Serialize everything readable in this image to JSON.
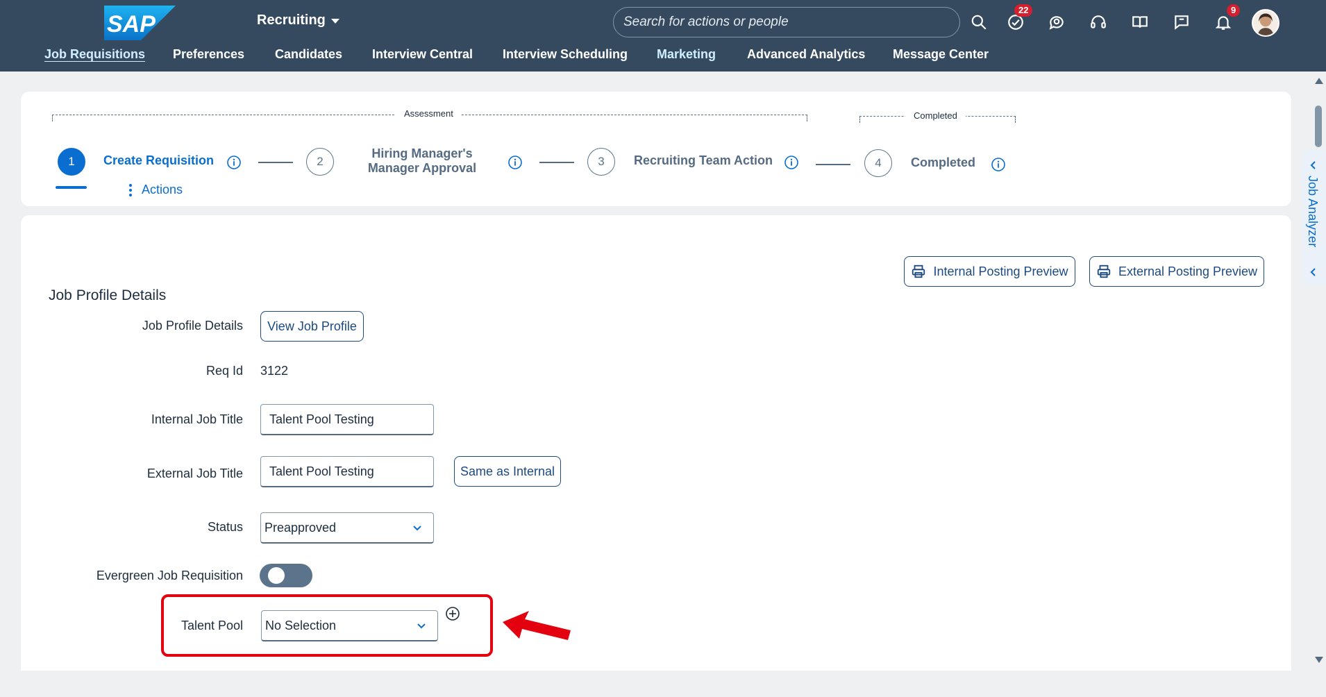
{
  "header": {
    "logo_text": "SAP",
    "app_switch_label": "Recruiting",
    "search_placeholder": "Search for actions or people",
    "todo_badge": "22",
    "notification_badge": "9"
  },
  "nav": {
    "items": [
      "Job Requisitions",
      "Preferences",
      "Candidates",
      "Interview Central",
      "Interview Scheduling",
      "Marketing",
      "Advanced Analytics",
      "Message Center"
    ]
  },
  "stepper": {
    "bracket_assessment": "Assessment",
    "bracket_completed": "Completed",
    "steps": [
      {
        "number": "1",
        "label": "Create Requisition"
      },
      {
        "number": "2",
        "label_line1": "Hiring Manager's",
        "label_line2": "Manager Approval"
      },
      {
        "number": "3",
        "label": "Recruiting Team Action"
      },
      {
        "number": "4",
        "label": "Completed"
      }
    ],
    "actions_label": "Actions"
  },
  "side_tab": {
    "label": "Job Analyzer"
  },
  "form": {
    "internal_preview_label": "Internal Posting Preview",
    "external_preview_label": "External Posting Preview",
    "section_title": "Job Profile Details",
    "job_profile_label": "Job Profile Details",
    "view_job_profile_label": "View Job Profile",
    "req_id_label": "Req Id",
    "req_id_value": "3122",
    "internal_title_label": "Internal Job Title",
    "internal_title_value": "Talent Pool Testing",
    "external_title_label": "External Job Title",
    "external_title_value": "Talent Pool Testing",
    "same_as_internal_label": "Same as Internal",
    "status_label": "Status",
    "status_value": "Preapproved",
    "evergreen_label": "Evergreen Job Requisition",
    "talent_pool_label": "Talent Pool",
    "talent_pool_value": "No Selection"
  },
  "colors": {
    "shell": "#354a5f",
    "accent": "#0a6ed1",
    "highlight": "#e3000f"
  }
}
